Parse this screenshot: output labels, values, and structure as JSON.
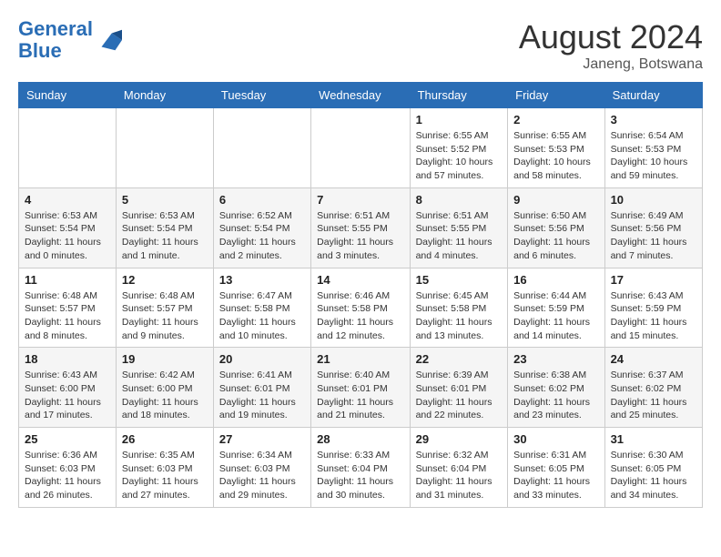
{
  "header": {
    "logo_line1": "General",
    "logo_line2": "Blue",
    "month_year": "August 2024",
    "location": "Janeng, Botswana"
  },
  "days_of_week": [
    "Sunday",
    "Monday",
    "Tuesday",
    "Wednesday",
    "Thursday",
    "Friday",
    "Saturday"
  ],
  "weeks": [
    [
      {
        "day": "",
        "info": ""
      },
      {
        "day": "",
        "info": ""
      },
      {
        "day": "",
        "info": ""
      },
      {
        "day": "",
        "info": ""
      },
      {
        "day": "1",
        "info": "Sunrise: 6:55 AM\nSunset: 5:52 PM\nDaylight: 10 hours and 57 minutes."
      },
      {
        "day": "2",
        "info": "Sunrise: 6:55 AM\nSunset: 5:53 PM\nDaylight: 10 hours and 58 minutes."
      },
      {
        "day": "3",
        "info": "Sunrise: 6:54 AM\nSunset: 5:53 PM\nDaylight: 10 hours and 59 minutes."
      }
    ],
    [
      {
        "day": "4",
        "info": "Sunrise: 6:53 AM\nSunset: 5:54 PM\nDaylight: 11 hours and 0 minutes."
      },
      {
        "day": "5",
        "info": "Sunrise: 6:53 AM\nSunset: 5:54 PM\nDaylight: 11 hours and 1 minute."
      },
      {
        "day": "6",
        "info": "Sunrise: 6:52 AM\nSunset: 5:54 PM\nDaylight: 11 hours and 2 minutes."
      },
      {
        "day": "7",
        "info": "Sunrise: 6:51 AM\nSunset: 5:55 PM\nDaylight: 11 hours and 3 minutes."
      },
      {
        "day": "8",
        "info": "Sunrise: 6:51 AM\nSunset: 5:55 PM\nDaylight: 11 hours and 4 minutes."
      },
      {
        "day": "9",
        "info": "Sunrise: 6:50 AM\nSunset: 5:56 PM\nDaylight: 11 hours and 6 minutes."
      },
      {
        "day": "10",
        "info": "Sunrise: 6:49 AM\nSunset: 5:56 PM\nDaylight: 11 hours and 7 minutes."
      }
    ],
    [
      {
        "day": "11",
        "info": "Sunrise: 6:48 AM\nSunset: 5:57 PM\nDaylight: 11 hours and 8 minutes."
      },
      {
        "day": "12",
        "info": "Sunrise: 6:48 AM\nSunset: 5:57 PM\nDaylight: 11 hours and 9 minutes."
      },
      {
        "day": "13",
        "info": "Sunrise: 6:47 AM\nSunset: 5:58 PM\nDaylight: 11 hours and 10 minutes."
      },
      {
        "day": "14",
        "info": "Sunrise: 6:46 AM\nSunset: 5:58 PM\nDaylight: 11 hours and 12 minutes."
      },
      {
        "day": "15",
        "info": "Sunrise: 6:45 AM\nSunset: 5:58 PM\nDaylight: 11 hours and 13 minutes."
      },
      {
        "day": "16",
        "info": "Sunrise: 6:44 AM\nSunset: 5:59 PM\nDaylight: 11 hours and 14 minutes."
      },
      {
        "day": "17",
        "info": "Sunrise: 6:43 AM\nSunset: 5:59 PM\nDaylight: 11 hours and 15 minutes."
      }
    ],
    [
      {
        "day": "18",
        "info": "Sunrise: 6:43 AM\nSunset: 6:00 PM\nDaylight: 11 hours and 17 minutes."
      },
      {
        "day": "19",
        "info": "Sunrise: 6:42 AM\nSunset: 6:00 PM\nDaylight: 11 hours and 18 minutes."
      },
      {
        "day": "20",
        "info": "Sunrise: 6:41 AM\nSunset: 6:01 PM\nDaylight: 11 hours and 19 minutes."
      },
      {
        "day": "21",
        "info": "Sunrise: 6:40 AM\nSunset: 6:01 PM\nDaylight: 11 hours and 21 minutes."
      },
      {
        "day": "22",
        "info": "Sunrise: 6:39 AM\nSunset: 6:01 PM\nDaylight: 11 hours and 22 minutes."
      },
      {
        "day": "23",
        "info": "Sunrise: 6:38 AM\nSunset: 6:02 PM\nDaylight: 11 hours and 23 minutes."
      },
      {
        "day": "24",
        "info": "Sunrise: 6:37 AM\nSunset: 6:02 PM\nDaylight: 11 hours and 25 minutes."
      }
    ],
    [
      {
        "day": "25",
        "info": "Sunrise: 6:36 AM\nSunset: 6:03 PM\nDaylight: 11 hours and 26 minutes."
      },
      {
        "day": "26",
        "info": "Sunrise: 6:35 AM\nSunset: 6:03 PM\nDaylight: 11 hours and 27 minutes."
      },
      {
        "day": "27",
        "info": "Sunrise: 6:34 AM\nSunset: 6:03 PM\nDaylight: 11 hours and 29 minutes."
      },
      {
        "day": "28",
        "info": "Sunrise: 6:33 AM\nSunset: 6:04 PM\nDaylight: 11 hours and 30 minutes."
      },
      {
        "day": "29",
        "info": "Sunrise: 6:32 AM\nSunset: 6:04 PM\nDaylight: 11 hours and 31 minutes."
      },
      {
        "day": "30",
        "info": "Sunrise: 6:31 AM\nSunset: 6:05 PM\nDaylight: 11 hours and 33 minutes."
      },
      {
        "day": "31",
        "info": "Sunrise: 6:30 AM\nSunset: 6:05 PM\nDaylight: 11 hours and 34 minutes."
      }
    ]
  ]
}
